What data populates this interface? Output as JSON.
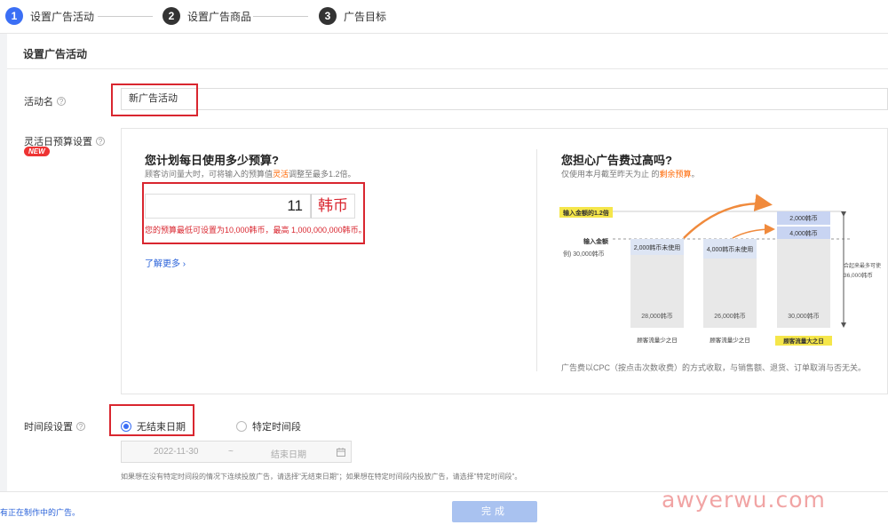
{
  "steps": [
    {
      "num": "1",
      "label": "设置广告活动"
    },
    {
      "num": "2",
      "label": "设置广告商品"
    },
    {
      "num": "3",
      "label": "广告目标"
    }
  ],
  "section_title": "设置广告活动",
  "campaign_name": {
    "label": "活动名",
    "value": "新广告活动"
  },
  "budget": {
    "label": "灵活日预算设置",
    "badge": "NEW",
    "heading": "您计划每日使用多少预算?",
    "sub_prefix": "顾客访问量大时，可将输入的预算值",
    "sub_highlight": "灵活",
    "sub_suffix": "调整至最多1.2倍。",
    "value": "11",
    "unit": "韩币",
    "error": "您的预算最低可设置为10,000韩币，最高 1,000,000,000韩币。",
    "learn_more": "了解更多"
  },
  "cost_info": {
    "heading": "您担心广告费过高吗?",
    "sub_prefix": "仅使用本月截至昨天为止 的",
    "sub_highlight": "剩余预算",
    "sub_suffix": "。",
    "footnote": "广告费以CPC（按点击次数收费）的方式收取，与销售额、退货、订单取消与否无关。"
  },
  "chart_labels": {
    "input_amount_max": "输入金额的1.2倍",
    "input_amount": "输入金额",
    "input_amount_example": "例) 30,000韩币",
    "bars": [
      {
        "top_label": "2,000韩币未使用",
        "bottom_label": "28,000韩币",
        "caption": "顾客流量少之日"
      },
      {
        "top_label": "4,000韩币未使用",
        "bottom_label": "26,000韩币",
        "caption": "顾客流量少之日"
      },
      {
        "top_label1": "2,000韩币",
        "top_label2": "4,000韩币",
        "bottom_label": "30,000韩币",
        "caption": "顾客流量大之日"
      }
    ],
    "side_note1": "合起来最多可使",
    "side_note2": "36,000韩币"
  },
  "time_period": {
    "label": "时间段设置",
    "option_no_end": "无结束日期",
    "option_specific": "特定时间段",
    "start_date": "2022-11-30",
    "separator": "~",
    "end_placeholder": "结束日期",
    "hint": "如果想在没有特定时间段的情况下连续投放广告，请选择\"无结束日期\"；如果想在特定时间段内投放广告，请选择\"特定时间段\"。"
  },
  "bottom": {
    "left_text": "有正在制作中的广告。",
    "done_label": "完成"
  },
  "watermark": "awyerwu.com",
  "colors": {
    "accent": "#3b6ff5",
    "error": "#d9262f",
    "highlight": "#f60"
  }
}
